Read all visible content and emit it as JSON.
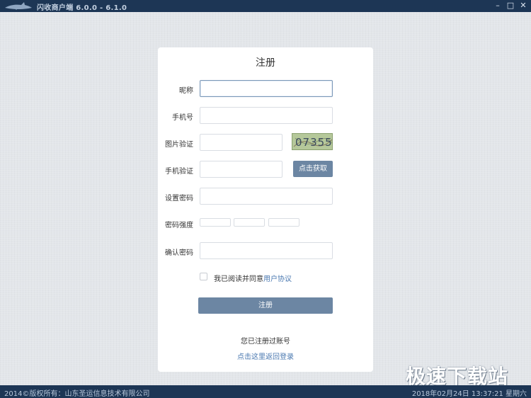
{
  "window": {
    "title": "闪收商户端  6.0.0 - 6.1.0",
    "minimize": "–",
    "maximize": "□",
    "close": "✕"
  },
  "form": {
    "title": "注册",
    "nickname_label": "昵称",
    "phone_label": "手机号",
    "image_code_label": "图片验证",
    "captcha_text": "07355",
    "sms_code_label": "手机验证",
    "get_code_button": "点击获取",
    "password_label": "设置密码",
    "strength_label": "密码强度",
    "confirm_label": "确认密码",
    "agree_text": "我已阅读并同意",
    "agree_link": "用户协议",
    "register_button": "注册",
    "already_registered": "您已注册过账号",
    "back_to_login": "点击这里返回登录"
  },
  "status": {
    "copyright": "2014©版权所有：山东圣运信息技术有限公司",
    "datetime": "2018年02月24日 13:37:21 星期六"
  },
  "watermark": "极速下载站",
  "colors": {
    "titlebar": "#1d3655",
    "button": "#6c86a3",
    "link": "#4a78b0",
    "captcha_bg": "#b5c89a"
  }
}
